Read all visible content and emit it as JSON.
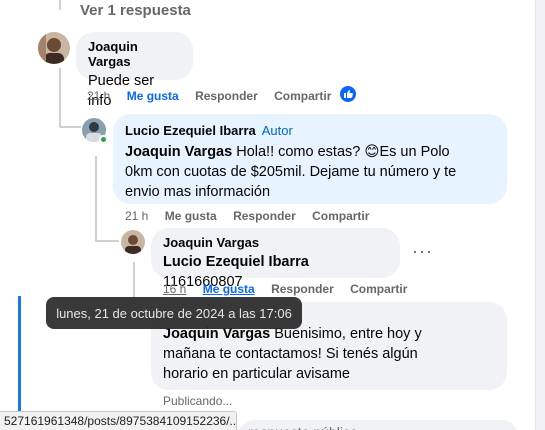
{
  "view_replies": "Ver 1 respuesta",
  "comments": [
    {
      "author": "Joaquin Vargas",
      "text": "Puede ser info",
      "time": "21 h",
      "like": "Me gusta",
      "reply": "Responder",
      "share": "Compartir"
    },
    {
      "author": "Lucio Ezequiel Ibarra",
      "badge": "Autor",
      "mention": "Joaquin Vargas",
      "text_line1": " Hola!! como estas? 😊Es un Polo",
      "text_line2": "0km con cuotas de $205mil. Dejame tu número y te",
      "text_line3": "envio mas información",
      "time": "21 h",
      "like": "Me gusta",
      "reply": "Responder",
      "share": "Compartir"
    },
    {
      "author": "Joaquin Vargas",
      "mention": "Lucio Ezequiel Ibarra",
      "text": " 1161660807",
      "time": "16 h",
      "like": "Me gusta",
      "reply": "Responder",
      "share": "Compartir",
      "more": "···"
    },
    {
      "mention": "Joaquin Vargas",
      "text_line1": " Buenisimo, entre hoy y",
      "text_line2": "mañana te contactamos! Si tenés algún",
      "text_line3": "horario en particular avisame"
    }
  ],
  "tooltip": "lunes, 21 de octubre de 2024 a las 17:06",
  "publishing": "Publicando...",
  "url_bar": "527161961348/posts/8975384109152236/...",
  "bottom_input": "respuesta pública",
  "colors": {
    "link_blue": "#0866ff",
    "bubble_gray": "#f0f2f5",
    "bubble_highlight": "#e7f3ff",
    "meta_gray": "#65676b"
  }
}
